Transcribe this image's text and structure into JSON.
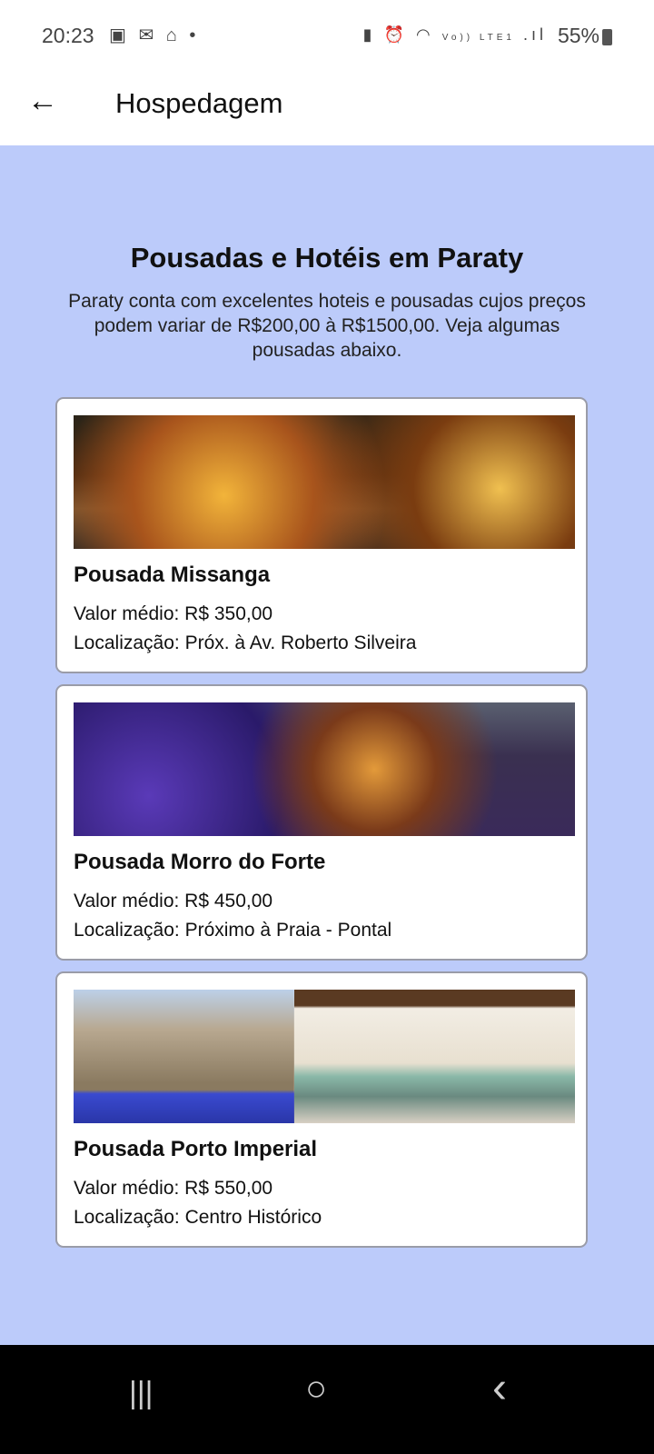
{
  "status_bar": {
    "time": "20:23",
    "battery": "55%",
    "left_icons": [
      "gallery-icon",
      "mail-icon",
      "hotspot-icon",
      "dot-icon"
    ],
    "right_icons": [
      "battery-saver-icon",
      "alarm-icon",
      "wifi-icon",
      "volte-icon",
      "signal-icon",
      "battery-icon"
    ],
    "volte_label": "Vo)) LTE1"
  },
  "app_bar": {
    "title": "Hospedagem",
    "back_icon": "arrow-left-icon"
  },
  "main": {
    "heading": "Pousadas e Hotéis em Paraty",
    "intro": "Paraty conta com excelentes hoteis e pousadas cujos preços podem variar de R$200,00 à R$1500,00. Veja algumas pousadas abaixo.",
    "cards": [
      {
        "name": "Pousada Missanga",
        "price": "Valor médio: R$ 350,00",
        "location": "Localização: Próx. à Av. Roberto Silveira"
      },
      {
        "name": "Pousada Morro do Forte",
        "price": "Valor médio: R$ 450,00",
        "location": "Localização: Próximo à Praia - Pontal"
      },
      {
        "name": "Pousada Porto Imperial",
        "price": "Valor médio: R$ 550,00",
        "location": "Localização: Centro Histórico"
      }
    ]
  },
  "nav_bar": {
    "recents": "|||",
    "home": "○",
    "back": "‹"
  },
  "colors": {
    "background": "#bccbfa",
    "card_border": "#9a9ca8"
  }
}
